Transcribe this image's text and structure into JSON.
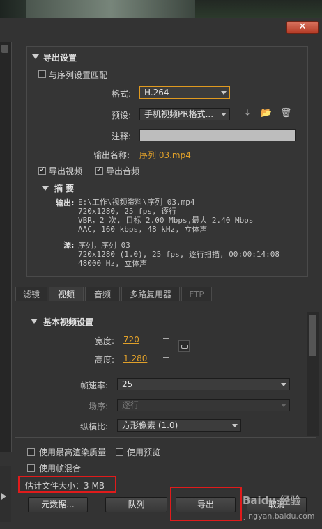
{
  "window": {
    "close_icon": "✕"
  },
  "export_settings": {
    "header": "导出设置",
    "match_sequence": "与序列设置匹配",
    "format_label": "格式:",
    "format_value": "H.264",
    "preset_label": "预设:",
    "preset_value": "手机视频PR格式...",
    "comments_label": "注释:",
    "output_name_label": "输出名称:",
    "output_name_value": "序列 03.mp4",
    "export_video": "导出视频",
    "export_audio": "导出音频",
    "summary_header": "摘 要",
    "output_label": "输出:",
    "output_lines": [
      "E:\\工作\\视频资料\\序列 03.mp4",
      "720x1280, 25 fps, 逐行",
      "VBR，2 次, 目标 2.00 Mbps,最大 2.40 Mbps",
      "AAC, 160 kbps, 48 kHz, 立体声"
    ],
    "source_label": "源:",
    "source_lines": [
      "序列，序列 03",
      "720x1280 (1.0), 25 fps, 逐行扫描, 00:00:14:08",
      "48000 Hz, 立体声"
    ]
  },
  "tabs": [
    "滤镜",
    "视频",
    "音频",
    "多路复用器",
    "FTP"
  ],
  "video": {
    "header": "基本视频设置",
    "width_label": "宽度:",
    "width_value": "720",
    "height_label": "高度:",
    "height_value": "1,280",
    "framerate_label": "帧速率:",
    "framerate_value": "25",
    "field_label": "场序:",
    "field_value": "逐行",
    "aspect_label": "纵横比:",
    "aspect_value": "方形像素 (1.0)"
  },
  "bottom": {
    "max_quality": "使用最高渲染质量",
    "use_preview": "使用预览",
    "frame_blend": "使用帧混合",
    "file_size": "估计文件大小：3 MB",
    "metadata_btn": "元数据...",
    "queue_btn": "队列",
    "export_btn": "导出",
    "cancel_btn": "取消",
    "watermark_text": "Baidu 经验",
    "watermark_url": "jingyan.baidu.com"
  }
}
